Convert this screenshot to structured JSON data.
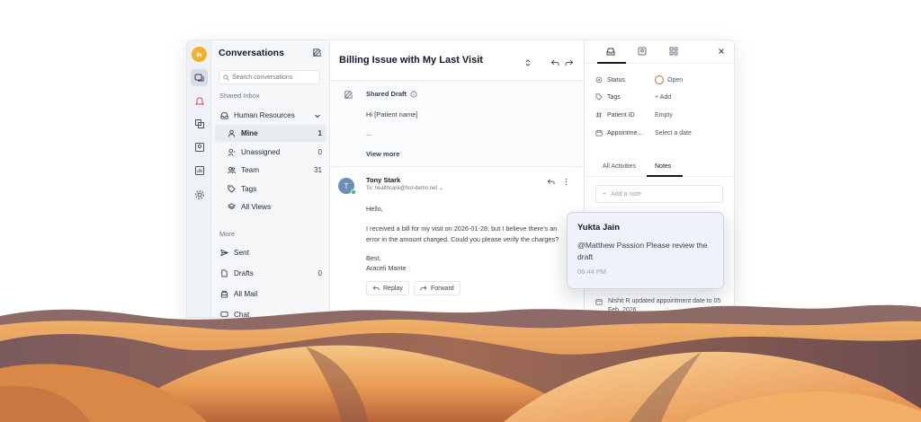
{
  "sidebar": {
    "title": "Conversations",
    "search_placeholder": "Search conversations",
    "shared_inbox_label": "Shared Inbox",
    "inbox_name": "Human Resources",
    "items": [
      {
        "label": "Mine",
        "count": "1"
      },
      {
        "label": "Unassigned",
        "count": "0"
      },
      {
        "label": "Team",
        "count": "31"
      },
      {
        "label": "Tags",
        "count": ""
      },
      {
        "label": "All Views",
        "count": ""
      }
    ],
    "more_label": "More",
    "more_items": [
      {
        "label": "Sent",
        "count": ""
      },
      {
        "label": "Drafts",
        "count": "0"
      },
      {
        "label": "All Mail",
        "count": ""
      },
      {
        "label": "Chat",
        "count": ""
      }
    ]
  },
  "main": {
    "title": "Billing Issue with My Last Visit",
    "draft": {
      "label": "Shared Draft",
      "line1": "Hi [Patient name]",
      "line2": "...",
      "view_more": "View more"
    },
    "message": {
      "avatar_initial": "T",
      "sender": "Tony Stark",
      "to": "To: healthcare@hot-demo.net",
      "greeting": "Hello,",
      "body1": "I received a bill for my visit on 2026-01-28, but I believe there's an",
      "body2": "error in the amount charged. Could you please verify the charges?",
      "sign1": "Best,",
      "sign2": "Araceli Mante",
      "reply_label": "Replay",
      "forward_label": "Forward"
    }
  },
  "details": {
    "fields": [
      {
        "key": "Status",
        "value": "Open"
      },
      {
        "key": "Tags",
        "value": "+ Add"
      },
      {
        "key": "Patient ID",
        "value": "Empty"
      },
      {
        "key": "Appointme...",
        "value": "Select a date"
      }
    ],
    "tabs": [
      "All Activities",
      "Notes"
    ],
    "note_placeholder": "Add a note",
    "activity": "Nishit R updated appointment date to 05 Feb, 2026"
  },
  "note_card": {
    "author": "Yukta Jain",
    "text": "@Matthew Passion Please review the draft",
    "time": "06:44 PM"
  },
  "colors": {
    "accent": "#f2b227",
    "status_open": "#ea5a2a",
    "sand_light": "#f3b56b",
    "sand_shadow": "#6e4a44"
  }
}
